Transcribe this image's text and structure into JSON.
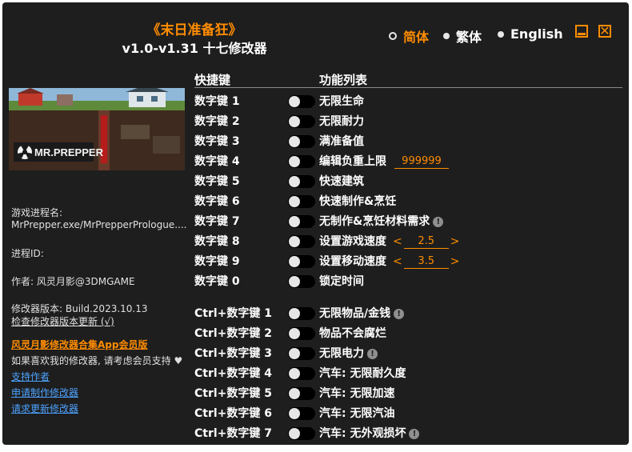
{
  "header": {
    "title": "《末日准备狂》",
    "subtitle": "v1.0-v1.31 十七修改器"
  },
  "languages": [
    {
      "label": "简体",
      "selected": true
    },
    {
      "label": "繁体",
      "selected": false
    },
    {
      "label": "English",
      "selected": false
    }
  ],
  "columns": {
    "hotkey": "快捷键",
    "features": "功能列表"
  },
  "game_image": {
    "logo_text": "MR.PREPPER"
  },
  "sidebar": {
    "process_label": "游戏进程名:",
    "process_value": "MrPrepper.exe/MrPrepperPrologue....",
    "pid_label": "进程ID:",
    "author": "作者: 风灵月影@3DMGAME",
    "version": "修改器版本: Build.2023.10.13",
    "check_update": "检查修改器版本更新 (√)",
    "app_promo": "风灵月影修改器合集App会员版",
    "support_text": "如果喜欢我的修改器, 请考虑会员支持",
    "heart": "♥",
    "link_support": "支持作者",
    "link_request": "申请制作修改器",
    "link_update": "请求更新修改器"
  },
  "cheats": [
    {
      "hotkey": "数字键 1",
      "label": "无限生命",
      "enabled": false
    },
    {
      "hotkey": "数字键 2",
      "label": "无限耐力",
      "enabled": false
    },
    {
      "hotkey": "数字键 3",
      "label": "满准备值",
      "enabled": false
    },
    {
      "hotkey": "数字键 4",
      "label": "编辑负重上限",
      "enabled": false,
      "value": "999999"
    },
    {
      "hotkey": "数字键 5",
      "label": "快速建筑",
      "enabled": false
    },
    {
      "hotkey": "数字键 6",
      "label": "快速制作&烹饪",
      "enabled": false
    },
    {
      "hotkey": "数字键 7",
      "label": "无制作&烹饪材料需求",
      "enabled": false,
      "info": "!"
    },
    {
      "hotkey": "数字键 8",
      "label": "设置游戏速度",
      "enabled": false,
      "value": "2.5",
      "arrows": [
        "<",
        ">"
      ]
    },
    {
      "hotkey": "数字键 9",
      "label": "设置移动速度",
      "enabled": false,
      "value": "3.5",
      "arrows": [
        "<",
        ">"
      ]
    },
    {
      "hotkey": "数字键 0",
      "label": "锁定时间",
      "enabled": false
    },
    {
      "hotkey": "Ctrl+数字键 1",
      "label": "无限物品/金钱",
      "enabled": false,
      "info": "!"
    },
    {
      "hotkey": "Ctrl+数字键 2",
      "label": "物品不会腐烂",
      "enabled": false
    },
    {
      "hotkey": "Ctrl+数字键 3",
      "label": "无限电力",
      "enabled": false,
      "info": "!"
    },
    {
      "hotkey": "Ctrl+数字键 4",
      "label": "汽车: 无限耐久度",
      "enabled": false
    },
    {
      "hotkey": "Ctrl+数字键 5",
      "label": "汽车: 无限加速",
      "enabled": false
    },
    {
      "hotkey": "Ctrl+数字键 6",
      "label": "汽车: 无限汽油",
      "enabled": false
    },
    {
      "hotkey": "Ctrl+数字键 7",
      "label": "汽车: 无外观损坏",
      "enabled": false,
      "info": "!"
    }
  ],
  "colors": {
    "accent": "#ff8c00",
    "background": "#1e1e1e",
    "link": "#4da3ff"
  }
}
